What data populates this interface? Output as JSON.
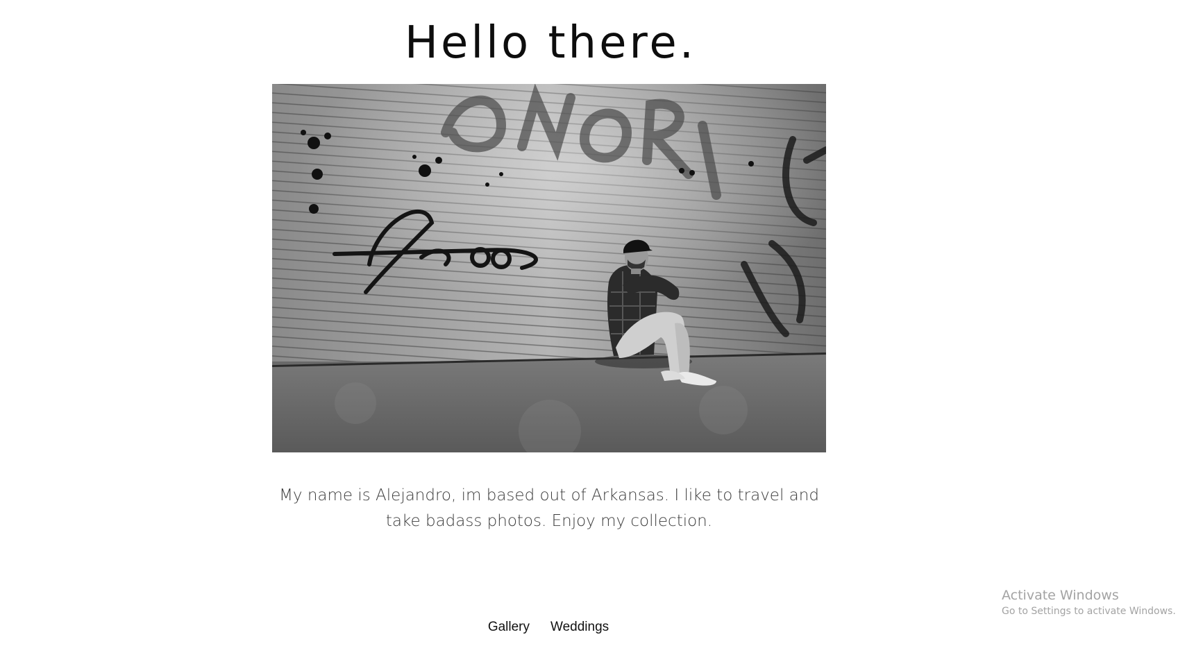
{
  "header": {
    "title": "Hello there."
  },
  "hero": {
    "alt": "Black and white photo of a man sitting against a graffiti-covered roll-up door"
  },
  "bio": {
    "text": "My name is Alejandro, im based out of Arkansas. I like to travel and take badass photos. Enjoy my collection."
  },
  "nav": {
    "items": [
      {
        "label": "Gallery"
      },
      {
        "label": "Weddings"
      }
    ]
  },
  "watermark": {
    "title": "Activate Windows",
    "subtitle": "Go to Settings to activate Windows."
  }
}
